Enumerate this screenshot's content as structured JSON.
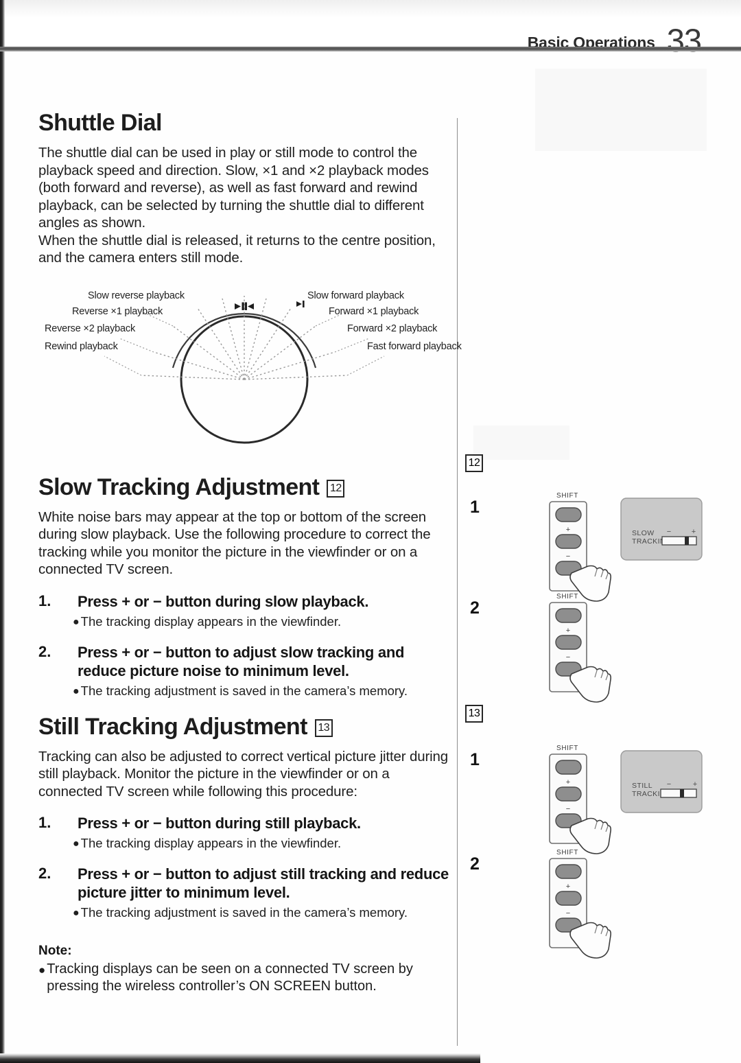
{
  "header": {
    "title": "Basic Operations",
    "page_number": "33"
  },
  "sections": {
    "shuttle": {
      "heading": "Shuttle Dial",
      "paragraph1": "The shuttle dial can be used in play or still mode to control the playback speed and direction. Slow, ×1 and ×2 playback modes (both forward and reverse), as well as fast forward and rewind playback, can be selected by turning the shuttle dial to different angles as shown.",
      "paragraph2": "When the shuttle dial is released, it returns to the centre position, and the camera enters still mode.",
      "diagram": {
        "center_marker": "▶|◀",
        "left_labels": [
          "Slow reverse playback",
          "Reverse ×1 playback",
          "Reverse ×2 playback",
          "Rewind playback"
        ],
        "right_labels": [
          "Slow forward playback",
          "Forward ×1 playback",
          "Forward ×2 playback",
          "Fast forward playback"
        ]
      }
    },
    "slow_tracking": {
      "heading": "Slow Tracking Adjustment",
      "badge": "12",
      "paragraph": "White noise bars may appear at the top or bottom of the screen during slow playback. Use the following procedure to correct the tracking while you monitor the picture in the viewfinder or on a connected TV screen.",
      "steps": [
        {
          "number": "1.",
          "title": "Press + or − button during slow playback.",
          "bullet": "The tracking display appears in the viewfinder."
        },
        {
          "number": "2.",
          "title": "Press + or − button to adjust slow tracking and reduce picture noise to minimum level.",
          "bullet": "The tracking adjustment is saved in the camera’s memory."
        }
      ]
    },
    "still_tracking": {
      "heading": "Still Tracking Adjustment",
      "badge": "13",
      "paragraph": "Tracking can also be adjusted to correct vertical picture jitter during still playback. Monitor the picture in the viewfinder or on a connected TV screen while following this procedure:",
      "steps": [
        {
          "number": "1.",
          "title": "Press + or − button during still playback.",
          "bullet": "The tracking display appears in the viewfinder."
        },
        {
          "number": "2.",
          "title": "Press + or − button to adjust still tracking and reduce picture jitter to minimum level.",
          "bullet": "The tracking adjustment is saved in the camera’s memory."
        }
      ]
    },
    "note": {
      "title": "Note:",
      "item": "Tracking displays can be seen on a connected TV screen by pressing the wireless controller’s ON SCREEN button."
    }
  },
  "figures": {
    "slow": {
      "badge": "12",
      "step1_num": "1",
      "step2_num": "2",
      "panel_label": "SHIFT",
      "plus_label": "+",
      "minus_label": "−",
      "tv_line1": "SLOW",
      "tv_line2": "TRACKING",
      "tv_minus": "−",
      "tv_plus": "+"
    },
    "still": {
      "badge": "13",
      "step1_num": "1",
      "step2_num": "2",
      "panel_label": "SHIFT",
      "plus_label": "+",
      "minus_label": "−",
      "tv_line1": "STILL",
      "tv_line2": "TRACKING",
      "tv_minus": "−",
      "tv_plus": "+"
    }
  }
}
